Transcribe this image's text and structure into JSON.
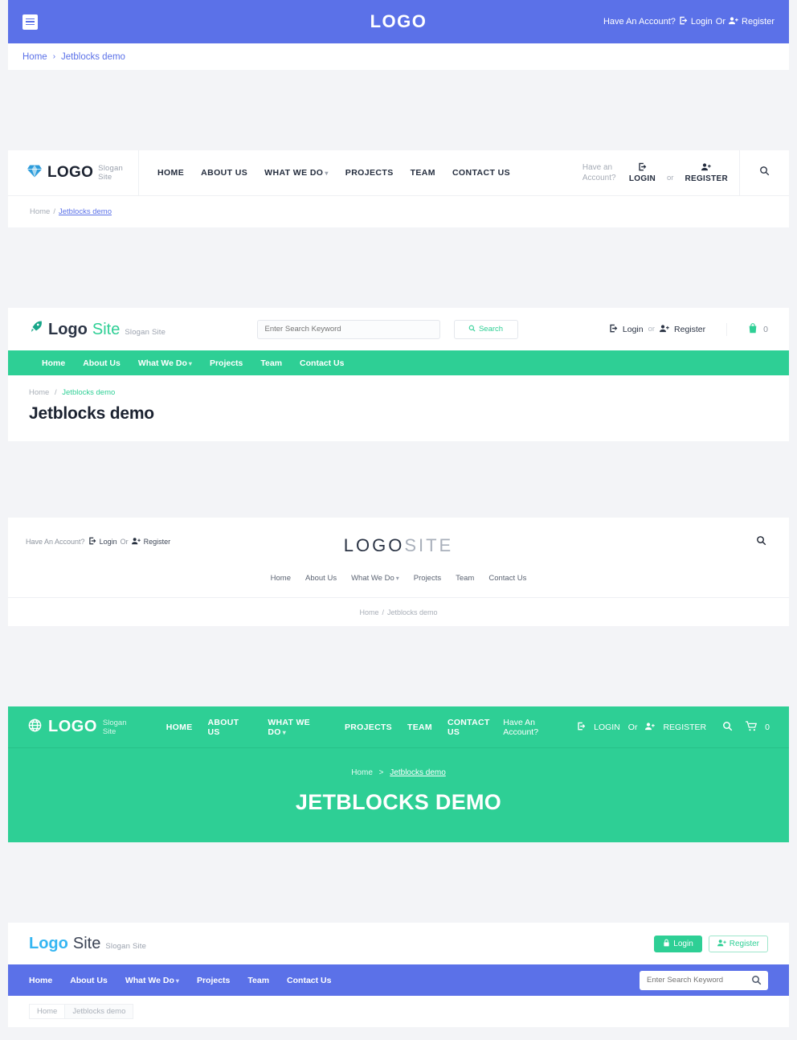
{
  "brand_colors": {
    "indigo": "#5b71e8",
    "green": "#2ecf95",
    "dark": "#1b2230",
    "muted": "#a6acb6",
    "cyan": "#35b6f2"
  },
  "page_title": "Jetblocks demo",
  "section1": {
    "menu_icon": "hamburger-icon",
    "logo": "LOGO",
    "account_prompt": "Have An Account?",
    "login_label": "Login",
    "or_label": "Or",
    "register_label": "Register",
    "login_icon": "sign-in-icon",
    "register_icon": "user-plus-icon",
    "breadcrumb": {
      "home": "Home",
      "separator": "›",
      "current": "Jetblocks demo"
    }
  },
  "section2": {
    "logo_icon": "diamond-icon",
    "logo": "LOGO",
    "slogan": "Slogan Site",
    "nav": [
      {
        "label": "HOME",
        "caret": false
      },
      {
        "label": "ABOUT US",
        "caret": false
      },
      {
        "label": "WHAT WE DO",
        "caret": true
      },
      {
        "label": "PROJECTS",
        "caret": false
      },
      {
        "label": "TEAM",
        "caret": false
      },
      {
        "label": "CONTACT US",
        "caret": false
      }
    ],
    "have_account": "Have an Account?",
    "login_label": "LOGIN",
    "or_label": "or",
    "register_label": "REGISTER",
    "search_icon": "search-icon",
    "breadcrumb": {
      "home": "Home",
      "separator": "/",
      "current": "Jetblocks demo"
    }
  },
  "section3": {
    "logo_icon": "rocket-icon",
    "logo_word1": "Logo",
    "logo_word2": "Site",
    "slogan": "Slogan Site",
    "search_placeholder": "Enter Search Keyword",
    "search_value": "",
    "search_button": "Search",
    "login_label": "Login",
    "or_label": "or",
    "register_label": "Register",
    "cart_icon": "shopping-bag-icon",
    "cart_count": "0",
    "nav": [
      {
        "label": "Home",
        "caret": false
      },
      {
        "label": "About Us",
        "caret": false
      },
      {
        "label": "What We Do",
        "caret": true
      },
      {
        "label": "Projects",
        "caret": false
      },
      {
        "label": "Team",
        "caret": false
      },
      {
        "label": "Contact Us",
        "caret": false
      }
    ],
    "breadcrumb": {
      "home": "Home",
      "separator": "/",
      "current": "Jetblocks demo"
    },
    "heading": "Jetblocks demo"
  },
  "section4": {
    "account_prompt": "Have An Account?",
    "login_label": "Login",
    "or_label": "Or",
    "register_label": "Register",
    "logo_word1": "LOGO",
    "logo_word2": "SITE",
    "search_icon": "search-icon",
    "nav": [
      {
        "label": "Home",
        "caret": false
      },
      {
        "label": "About Us",
        "caret": false
      },
      {
        "label": "What We Do",
        "caret": true
      },
      {
        "label": "Projects",
        "caret": false
      },
      {
        "label": "Team",
        "caret": false
      },
      {
        "label": "Contact Us",
        "caret": false
      }
    ],
    "breadcrumb": {
      "home": "Home",
      "separator": "/",
      "current": "Jetblocks demo"
    }
  },
  "section5": {
    "logo_icon": "globe-icon",
    "logo": "LOGO",
    "slogan": "Slogan Site",
    "nav": [
      {
        "label": "HOME",
        "caret": false
      },
      {
        "label": "ABOUT US",
        "caret": false
      },
      {
        "label": "WHAT WE DO",
        "caret": true
      },
      {
        "label": "PROJECTS",
        "caret": false
      },
      {
        "label": "TEAM",
        "caret": false
      },
      {
        "label": "CONTACT US",
        "caret": false
      }
    ],
    "account_prompt": "Have An Account?",
    "login_label": "LOGIN",
    "or_label": "Or",
    "register_label": "REGISTER",
    "search_icon": "search-icon",
    "cart_icon": "cart-icon",
    "cart_count": "0",
    "breadcrumb": {
      "home": "Home",
      "separator": ">",
      "current": "Jetblocks demo"
    },
    "heading": "JETBLOCKS DEMO"
  },
  "section6": {
    "logo_word1": "Logo",
    "logo_word2": "Site",
    "slogan": "Slogan Site",
    "login_label": "Login",
    "login_icon": "lock-icon",
    "register_label": "Register",
    "register_icon": "user-plus-icon",
    "nav": [
      {
        "label": "Home",
        "caret": false
      },
      {
        "label": "About Us",
        "caret": false
      },
      {
        "label": "What We Do",
        "caret": true
      },
      {
        "label": "Projects",
        "caret": false
      },
      {
        "label": "Team",
        "caret": false
      },
      {
        "label": "Contact Us",
        "caret": false
      }
    ],
    "search_placeholder": "Enter Search Keyword",
    "search_value": "",
    "search_icon": "search-icon",
    "breadcrumb": {
      "home": "Home",
      "current": "Jetblocks demo"
    }
  }
}
